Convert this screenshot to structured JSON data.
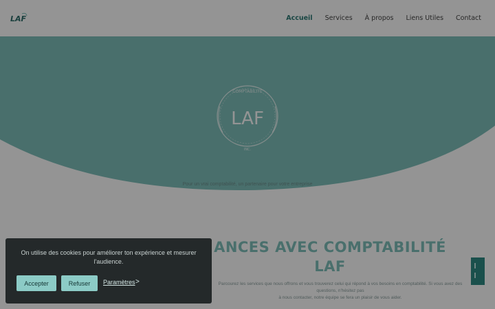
{
  "header": {
    "logo_text": "LAF",
    "nav": [
      {
        "label": "Accueil",
        "active": true
      },
      {
        "label": "Services",
        "active": false
      },
      {
        "label": "À propos",
        "active": false
      },
      {
        "label": "Liens Utiles",
        "active": false
      },
      {
        "label": "Contact",
        "active": false
      }
    ]
  },
  "hero": {
    "logo_text": "LAF",
    "logo_ring_text": "COMPTABILITÉ",
    "logo_bottom_text": "INC.",
    "tagline": "Pour un vrai comptabilité, un partenaire pour votre entreprise"
  },
  "main": {
    "title_line1": "ANCES AVEC COMPTABILITÉ",
    "title_line2": "LAF",
    "body_line1": "Parcourez les services que nous offrons et vous trouverez celui qui répond à vos besoins en comptabilité. Si vous avez des questions, n'hésitez pas",
    "body_line2": "à nous contacter, notre équipe se fera un plaisir de vous aider."
  },
  "cookie": {
    "message": "On utilise des cookies pour améliorer ton expérience et mesurer l'audience.",
    "accept_label": "Accepter",
    "refuse_label": "Refuser",
    "settings_label": "Paramètres",
    "settings_arrow": ">"
  },
  "colors": {
    "teal": "#7fc0bb",
    "teal_dark": "#2e7a76",
    "button": "#8ccbc6",
    "banner": "#24292a"
  }
}
